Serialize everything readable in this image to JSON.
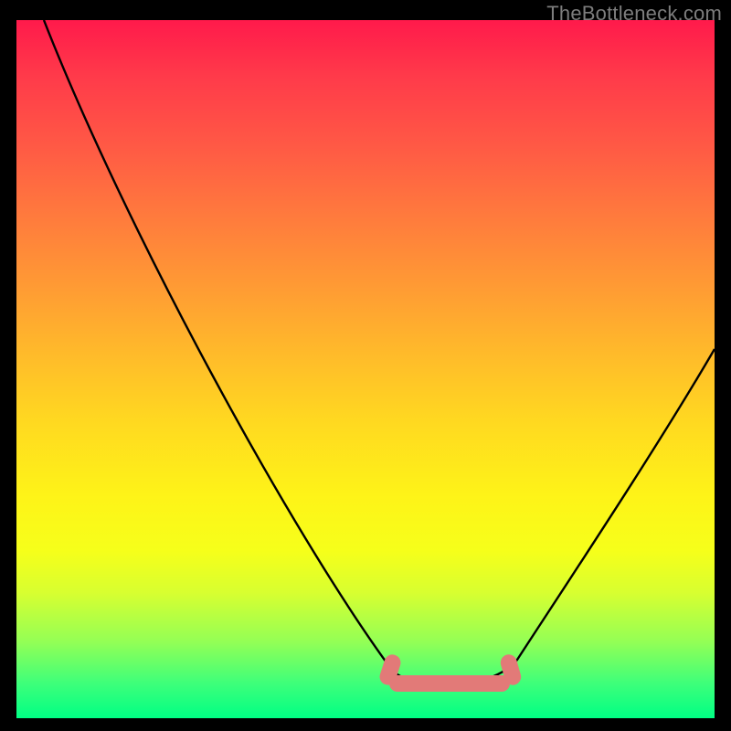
{
  "watermark": "TheBottleneck.com",
  "chart_data": {
    "type": "line",
    "title": "",
    "xlabel": "",
    "ylabel": "",
    "xlim": [
      0,
      100
    ],
    "ylim": [
      0,
      100
    ],
    "grid": false,
    "legend": false,
    "series": [
      {
        "name": "bottleneck-curve",
        "x": [
          4,
          10,
          20,
          30,
          40,
          50,
          55,
          58,
          62,
          66,
          70,
          72,
          80,
          90,
          100
        ],
        "y": [
          100,
          87,
          70,
          53,
          36,
          19,
          10,
          5,
          5,
          5,
          5,
          7,
          20,
          38,
          55
        ]
      }
    ],
    "highlight_segment": {
      "name": "optimal-range",
      "x_start": 55,
      "x_end": 72,
      "color": "#e27a78"
    },
    "background_gradient": {
      "stops": [
        {
          "pos": 0.0,
          "color": "#ff1a4b"
        },
        {
          "pos": 0.5,
          "color": "#ffda20"
        },
        {
          "pos": 0.8,
          "color": "#f6ff1a"
        },
        {
          "pos": 1.0,
          "color": "#00ff84"
        }
      ]
    }
  }
}
